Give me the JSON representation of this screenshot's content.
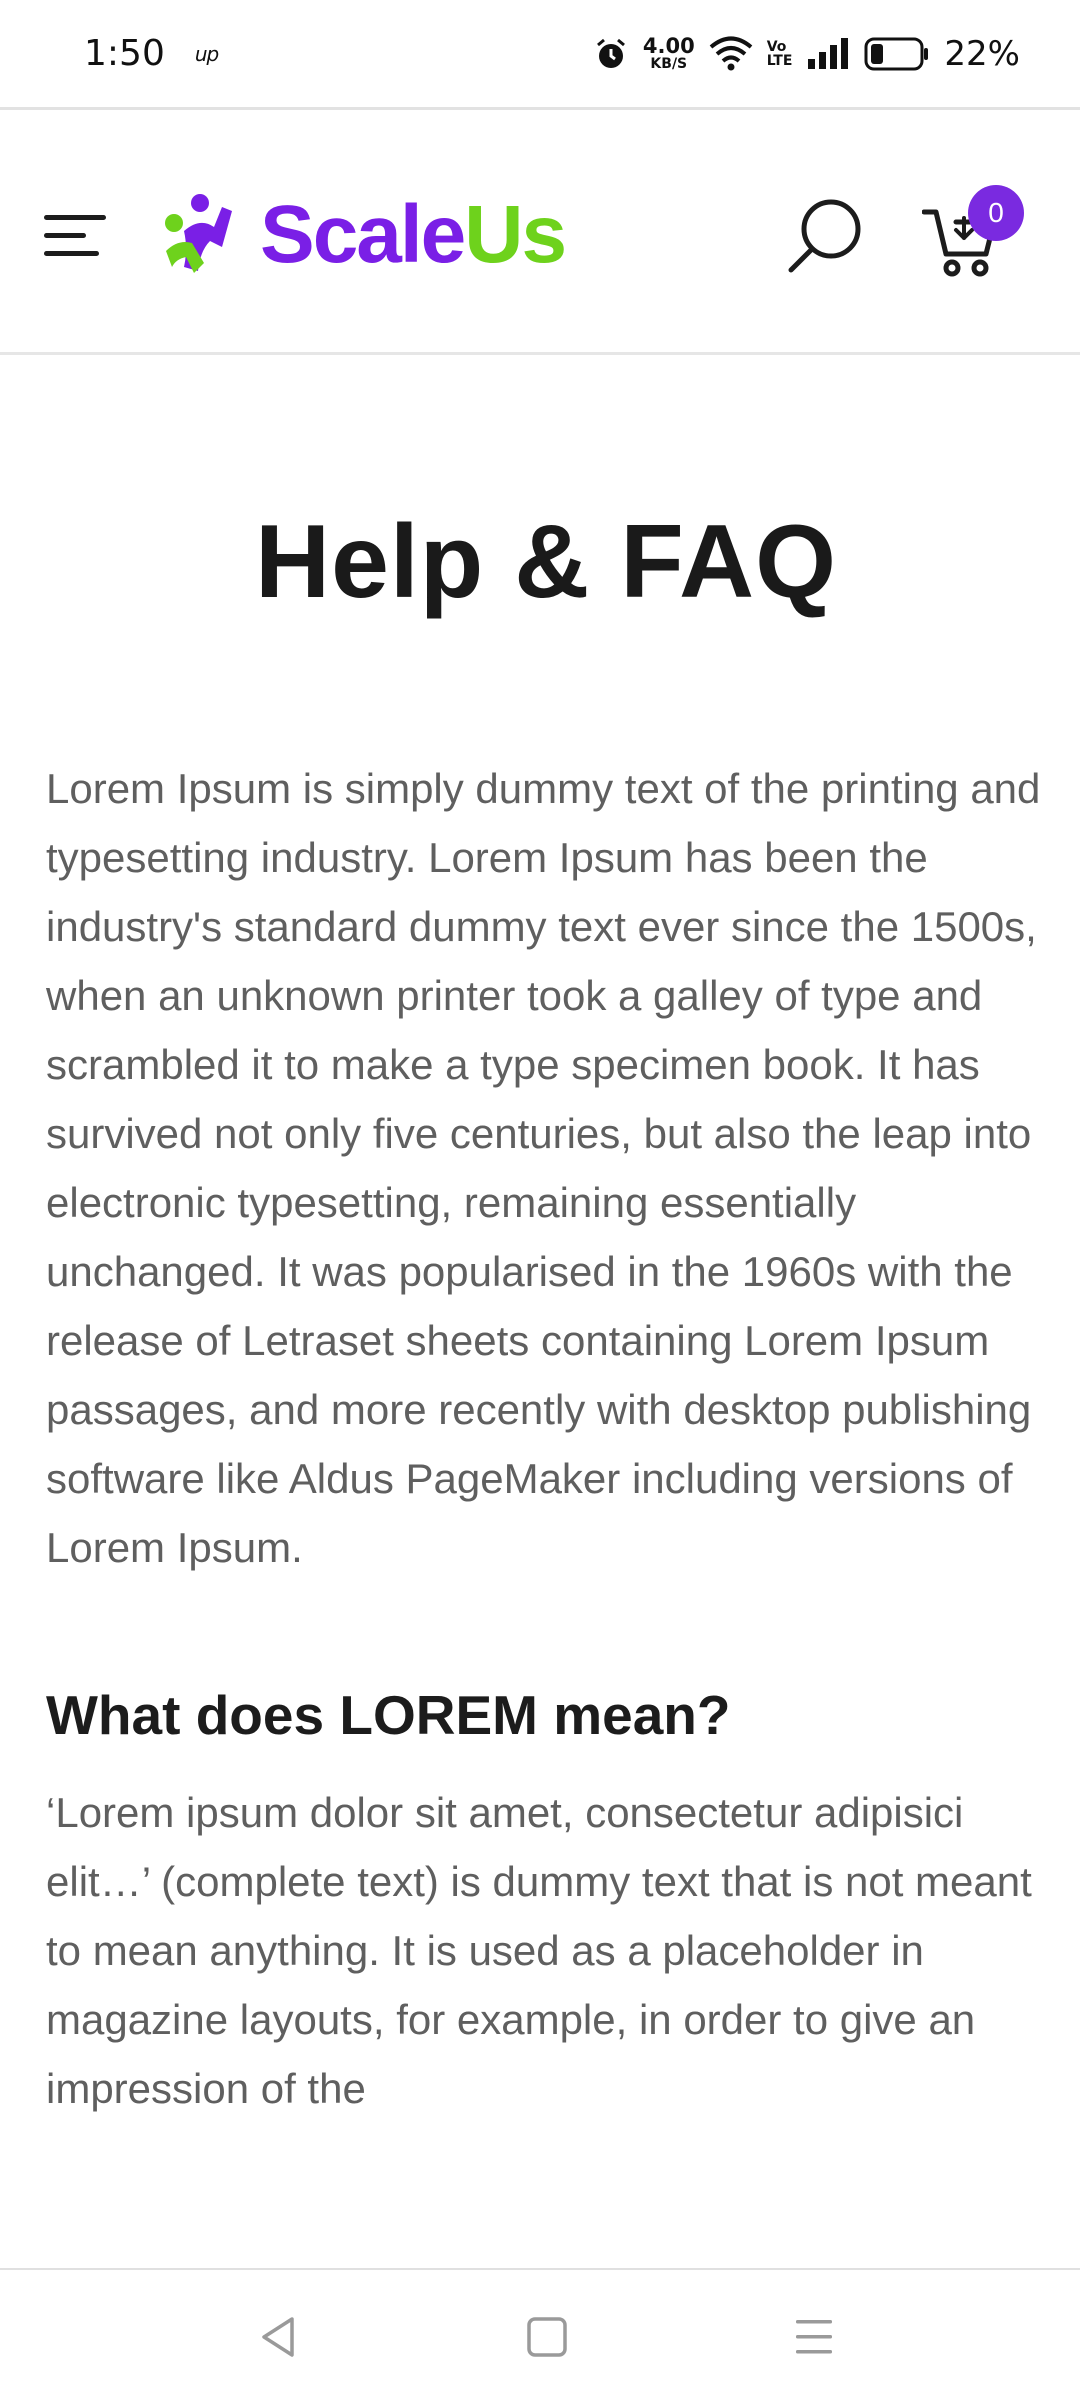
{
  "status_bar": {
    "time": "1:50",
    "carrier_label": "up",
    "net_speed_value": "4.00",
    "net_speed_unit": "KB/S",
    "volte_top": "Vo",
    "volte_bottom": "LTE",
    "battery_percent": "22%"
  },
  "header": {
    "logo_part1": "Scale",
    "logo_part2": "Us",
    "cart_count": "0",
    "brand_purple": "#7a1fe6",
    "brand_green": "#6ed21c"
  },
  "page": {
    "title": "Help & FAQ",
    "intro": "Lorem Ipsum is simply dummy text of the printing and typesetting industry. Lorem Ipsum has been the industry's standard dummy text ever since the 1500s, when an unknown printer took a galley of type and scrambled it to make a type specimen book. It has survived not only five centuries, but also the leap into electronic typesetting, remaining essentially unchanged. It was popularised in the 1960s with the release of Letraset sheets containing Lorem Ipsum passages, and more recently with desktop publishing software like Aldus PageMaker including versions of Lorem Ipsum.",
    "section_heading": "What does LOREM mean?",
    "section_text": "‘Lorem ipsum dolor sit amet, consectetur adipisici elit…’ (complete text) is dummy text that is not meant to mean anything. It is used as a placeholder in magazine layouts, for example, in order to give an impression of the"
  },
  "icons": {
    "menu": "hamburger-icon",
    "search": "search-icon",
    "cart": "cart-icon",
    "back": "back-triangle-icon",
    "home": "home-square-icon",
    "recents": "recents-lines-icon"
  }
}
